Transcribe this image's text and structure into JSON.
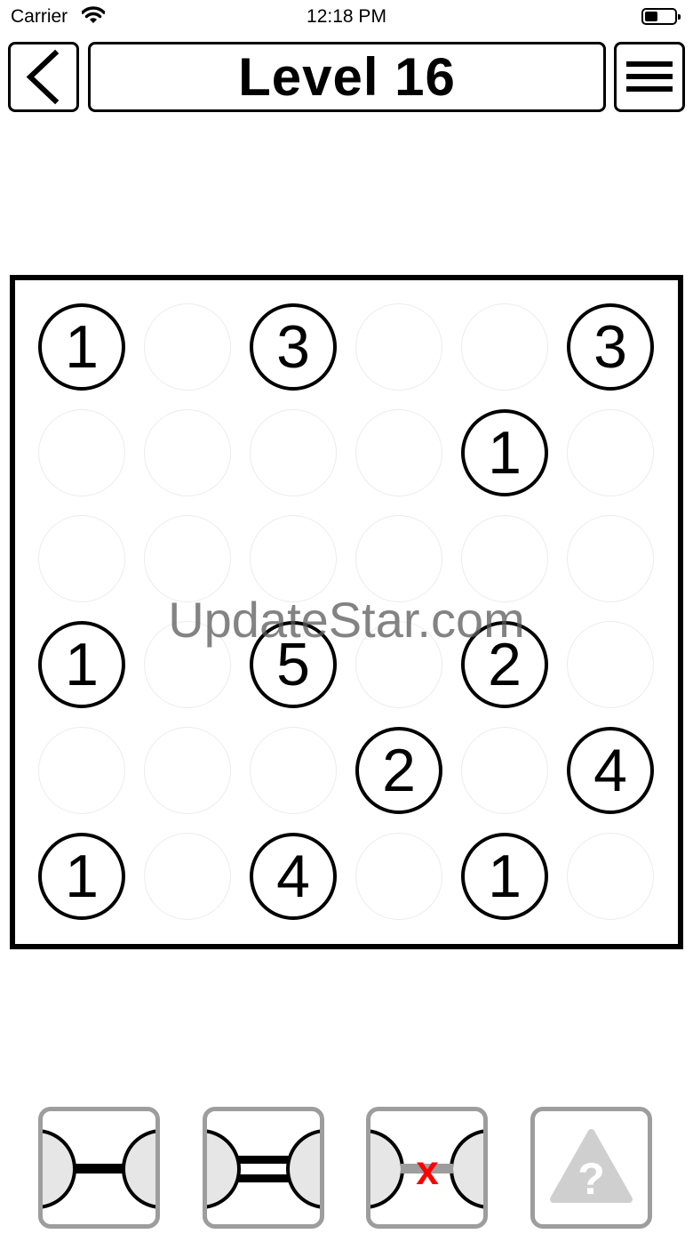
{
  "status_bar": {
    "carrier": "Carrier",
    "time": "12:18 PM"
  },
  "header": {
    "title": "Level 16"
  },
  "watermark": "UpdateStar.com",
  "board": {
    "rows": 6,
    "cols": 6,
    "islands": [
      {
        "row": 0,
        "col": 0,
        "value": "1"
      },
      {
        "row": 0,
        "col": 2,
        "value": "3"
      },
      {
        "row": 0,
        "col": 5,
        "value": "3"
      },
      {
        "row": 1,
        "col": 4,
        "value": "1"
      },
      {
        "row": 3,
        "col": 0,
        "value": "1"
      },
      {
        "row": 3,
        "col": 2,
        "value": "5"
      },
      {
        "row": 3,
        "col": 4,
        "value": "2"
      },
      {
        "row": 4,
        "col": 3,
        "value": "2"
      },
      {
        "row": 4,
        "col": 5,
        "value": "4"
      },
      {
        "row": 5,
        "col": 0,
        "value": "1"
      },
      {
        "row": 5,
        "col": 2,
        "value": "4"
      },
      {
        "row": 5,
        "col": 4,
        "value": "1"
      }
    ]
  },
  "tools": [
    {
      "name": "single-bridge-tool",
      "icon": "single-bridge-icon"
    },
    {
      "name": "double-bridge-tool",
      "icon": "double-bridge-icon"
    },
    {
      "name": "remove-bridge-tool",
      "icon": "remove-bridge-icon",
      "mark": "x",
      "mark_color": "#ff0000"
    },
    {
      "name": "hint-tool",
      "icon": "hint-warning-icon",
      "mark": "?",
      "mark_color": "#cfcfcf"
    }
  ]
}
